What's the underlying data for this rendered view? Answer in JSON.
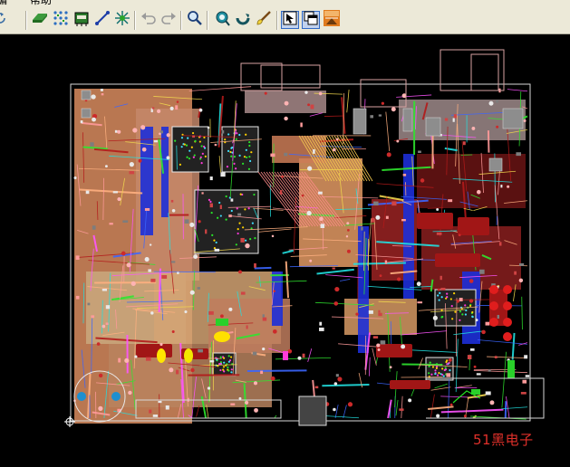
{
  "menu": {
    "partial_item_left": "编",
    "help_label": "帮助"
  },
  "toolbar": {
    "buttons": [
      {
        "icon": "redraw-icon"
      },
      {
        "icon": "route-icon"
      },
      {
        "icon": "fanout-icon"
      },
      {
        "icon": "component-icon"
      },
      {
        "icon": "connection-icon"
      },
      {
        "icon": "pin-swap-icon"
      },
      {
        "icon": "undo-icon"
      },
      {
        "icon": "redo-icon"
      },
      {
        "icon": "zoom-icon"
      },
      {
        "icon": "view-icon"
      },
      {
        "icon": "rotate-icon"
      },
      {
        "icon": "brush-icon"
      },
      {
        "icon": "select-mode-icon",
        "pressed": true
      },
      {
        "icon": "window-mode-icon",
        "pressed": true
      },
      {
        "icon": "pads-logo-icon"
      }
    ]
  },
  "canvas": {
    "background_color": "#000000",
    "board_outline_color": "#d8d8d8"
  },
  "watermark": "51黑电子"
}
